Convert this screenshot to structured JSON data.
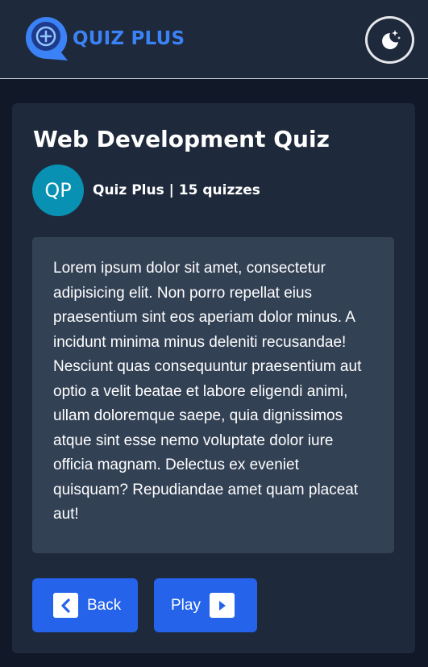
{
  "header": {
    "brand": "QUIZ PLUS",
    "logo_icon": "quiz-plus-logo",
    "theme_toggle_icon": "moon-stars-icon"
  },
  "quiz": {
    "title": "Web Development Quiz",
    "author_initials": "QP",
    "author_name": "Quiz Plus",
    "separator": " | ",
    "quiz_count": "15",
    "quiz_count_suffix": " quizzes",
    "description": "Lorem ipsum dolor sit amet, consectetur adipisicing elit. Non porro repellat eius praesentium sint eos aperiam dolor minus. A incidunt minima minus deleniti recusandae! Nesciunt quas consequuntur praesentium aut optio a velit beatae et labore eligendi animi, ullam doloremque saepe, quia dignissimos atque sint esse nemo voluptate dolor iure officia magnam. Delectus ex eveniet quisquam? Repudiandae amet quam placeat aut!"
  },
  "actions": {
    "back_label": "Back",
    "play_label": "Play"
  },
  "colors": {
    "page_bg": "#111827",
    "surface": "#1e293b",
    "panel": "#334155",
    "accent": "#2563eb",
    "brand": "#3b82f6",
    "avatar": "#0891b2"
  }
}
